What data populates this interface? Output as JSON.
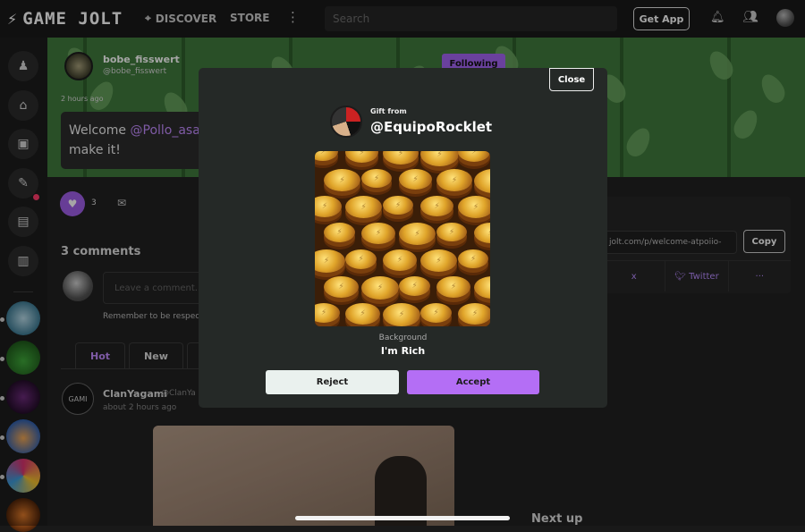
{
  "topbar": {
    "logo_text": "GAME JOLT",
    "discover_label": "DISCOVER",
    "store_label": "STORE",
    "more_icon": "⋮",
    "search_placeholder": "Search",
    "get_app_label": "Get App"
  },
  "post": {
    "author_name": "bobe_fisswert",
    "author_handle": "@bobe_fisswert",
    "following_label": "Following",
    "time_ago": "2 hours ago",
    "text_before": "Welcome ",
    "mention": "@Pollo_asad",
    "text_after": "make it!",
    "like_count": "3",
    "comments_title": "3 comments",
    "comment_placeholder": "Leave a comment...",
    "remember_text": "Remember to be respect",
    "tabs": [
      "Hot",
      "New",
      "▾"
    ]
  },
  "comment": {
    "name": "ClanYagami",
    "handle": "@ClanYa",
    "time": "about 2 hours ago",
    "avatar_text": "GAMI"
  },
  "share": {
    "url": "jolt.com/p/welcome-atpoiio-",
    "copy_label": "Copy",
    "cells": [
      "x",
      "Twitter",
      "···"
    ]
  },
  "next_up": "Next up",
  "modal": {
    "close_label": "Close",
    "gift_from_label": "Gift from",
    "sender": "@EquipoRocklet",
    "background_label": "Background",
    "background_name": "I'm Rich",
    "reject_label": "Reject",
    "accept_label": "Accept"
  },
  "colors": {
    "accent": "#b46ef5",
    "background": "#191919",
    "modal": "#252927"
  }
}
